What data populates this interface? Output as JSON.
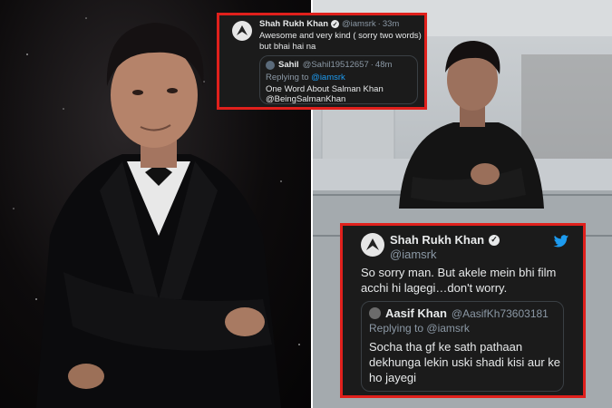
{
  "top_tweet": {
    "author_name": "Shah Rukh Khan",
    "handle": "@iamsrk",
    "time": "33m",
    "text_line1": "Awesome and very kind ( sorry two words)",
    "text_line2": "but bhai hai na",
    "quote": {
      "author_name": "Sahil",
      "handle": "@Sahil19512657",
      "time": "48m",
      "replying_prefix": "Replying to",
      "replying_handle": "@iamsrk",
      "text_line1": "One Word About Salman Khan",
      "text_line2": "@BeingSalmanKhan"
    }
  },
  "bottom_tweet": {
    "author_name": "Shah Rukh Khan",
    "handle": "@iamsrk",
    "text_line1": "So sorry man. But akele mein bhi film",
    "text_line2": "acchi hi lagegi…don't worry.",
    "quote": {
      "author_name": "Aasif Khan",
      "handle": "@AasifKh73603181",
      "replying_prefix": "Replying to",
      "replying_handle": "@iamsrk",
      "text_line1": "Socha tha gf ke sath pathaan",
      "text_line2": "dekhunga lekin uski shadi kisi aur ke",
      "text_line3": "ho jayegi"
    }
  },
  "colors": {
    "highlight_border": "#e0201c",
    "twitter_blue": "#1d9bf0",
    "tweet_bg": "#1b1b1b"
  },
  "icons": [
    "verified-badge-icon",
    "twitter-bird-icon",
    "avatar-logo-icon"
  ]
}
